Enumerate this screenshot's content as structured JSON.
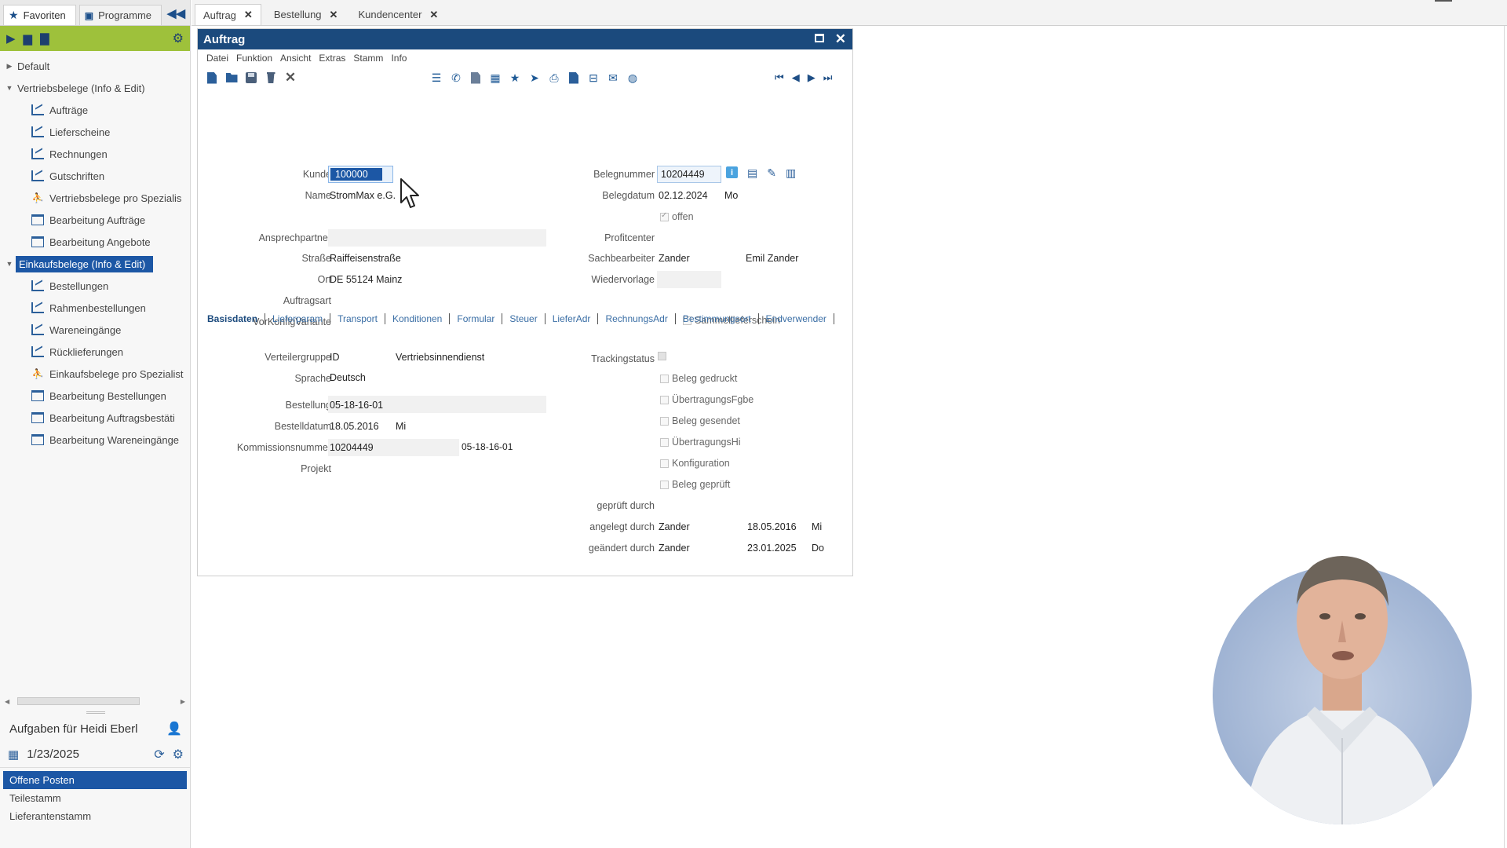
{
  "sidebar": {
    "tabs": [
      {
        "label": "Favoriten",
        "icon": "star-icon"
      },
      {
        "label": "Programme",
        "icon": "programs-icon"
      }
    ],
    "tree": [
      {
        "label": "Default",
        "level": 0,
        "expanded": false
      },
      {
        "label": "Vertriebsbelege (Info & Edit)",
        "level": 0,
        "expanded": true
      },
      {
        "label": "Aufträge",
        "level": 1,
        "icon": "chart-icon"
      },
      {
        "label": "Lieferscheine",
        "level": 1,
        "icon": "chart-icon"
      },
      {
        "label": "Rechnungen",
        "level": 1,
        "icon": "chart-icon"
      },
      {
        "label": "Gutschriften",
        "level": 1,
        "icon": "chart-icon"
      },
      {
        "label": "Vertriebsbelege pro Spezialis",
        "level": 1,
        "icon": "people-icon"
      },
      {
        "label": "Bearbeitung Aufträge",
        "level": 1,
        "icon": "window-icon"
      },
      {
        "label": "Bearbeitung Angebote",
        "level": 1,
        "icon": "window-icon"
      },
      {
        "label": "Einkaufsbelege (Info & Edit)",
        "level": 0,
        "expanded": true,
        "selected": true
      },
      {
        "label": "Bestellungen",
        "level": 1,
        "icon": "chart-icon"
      },
      {
        "label": "Rahmenbestellungen",
        "level": 1,
        "icon": "chart-icon"
      },
      {
        "label": "Wareneingänge",
        "level": 1,
        "icon": "chart-icon"
      },
      {
        "label": "Rücklieferungen",
        "level": 1,
        "icon": "chart-icon"
      },
      {
        "label": "Einkaufsbelege pro Spezialist",
        "level": 1,
        "icon": "people-icon"
      },
      {
        "label": "Bearbeitung Bestellungen",
        "level": 1,
        "icon": "window-icon"
      },
      {
        "label": "Bearbeitung Auftragsbestäti",
        "level": 1,
        "icon": "window-icon"
      },
      {
        "label": "Bearbeitung Wareneingänge",
        "level": 1,
        "icon": "window-icon"
      }
    ],
    "tasks": {
      "title": "Aufgaben für Heidi Eberl",
      "date": "1/23/2025",
      "items": [
        {
          "label": "Offene Posten",
          "active": true
        },
        {
          "label": "Teilestamm",
          "active": false
        },
        {
          "label": "Lieferantenstamm",
          "active": false
        }
      ]
    }
  },
  "doc_tabs": [
    {
      "label": "Auftrag",
      "active": true
    },
    {
      "label": "Bestellung",
      "active": false
    },
    {
      "label": "Kundencenter",
      "active": false
    }
  ],
  "window": {
    "title": "Auftrag",
    "menu": [
      "Datei",
      "Funktion",
      "Ansicht",
      "Extras",
      "Stamm",
      "Info"
    ]
  },
  "form": {
    "kunde_label": "Kunde",
    "kunde_value": "100000",
    "name_label": "Name",
    "name_value": "StromMax e.G.",
    "ansprechpartner_label": "Ansprechpartner",
    "strasse_label": "Straße",
    "strasse_value": "Raiffeisenstraße",
    "ort_label": "Ort",
    "ort_value": "DE 55124 Mainz",
    "auftragsart_label": "Auftragsart",
    "vorkonfig_label": "VorKonfigVariante",
    "belegnummer_label": "Belegnummer",
    "belegnummer_value": "10204449",
    "belegdatum_label": "Belegdatum",
    "belegdatum_value": "02.12.2024",
    "belegdatum_day": "Mo",
    "offen_label": "offen",
    "profitcenter_label": "Profitcenter",
    "sachbearbeiter_label": "Sachbearbeiter",
    "sachbearbeiter_value": "Zander",
    "sachbearbeiter_fullname": "Emil Zander",
    "wiedervorlage_label": "Wiedervorlage",
    "sammellieferschein_label": "Sammellieferschein"
  },
  "form_tabs": [
    "Basisdaten",
    "Lieferparam",
    "Transport",
    "Konditionen",
    "Formular",
    "Steuer",
    "LieferAdr",
    "RechnungsAdr",
    "Bestimmungsort",
    "Endverwender"
  ],
  "basisdaten": {
    "verteilergruppe_label": "Verteilergruppe",
    "verteilergruppe_id": "ID",
    "verteilergruppe_name": "Vertriebsinnendienst",
    "sprache_label": "Sprache",
    "sprache_value": "Deutsch",
    "bestellung_label": "Bestellung",
    "bestellung_value": "05-18-16-01",
    "bestelldatum_label": "Bestelldatum",
    "bestelldatum_value": "18.05.2016",
    "bestelldatum_day": "Mi",
    "kommission_label": "Kommissionsnummer",
    "kommission_value": "10204449",
    "kommission_ref": "05-18-16-01",
    "projekt_label": "Projekt",
    "trackingstatus_label": "Trackingstatus",
    "checks": [
      "Beleg gedruckt",
      "ÜbertragungsFgbe",
      "Beleg gesendet",
      "ÜbertragungsHi",
      "Konfiguration",
      "Beleg geprüft"
    ],
    "geprueft_label": "geprüft durch",
    "angelegt_label": "angelegt durch",
    "angelegt_user": "Zander",
    "angelegt_date": "18.05.2016",
    "angelegt_day": "Mi",
    "geaendert_label": "geändert durch",
    "geaendert_user": "Zander",
    "geaendert_date": "23.01.2025",
    "geaendert_day": "Do"
  },
  "colors": {
    "title_bar": "#1b4a7d",
    "selection": "#1c57a5",
    "sidebar_toolbar": "#9ec13b"
  }
}
